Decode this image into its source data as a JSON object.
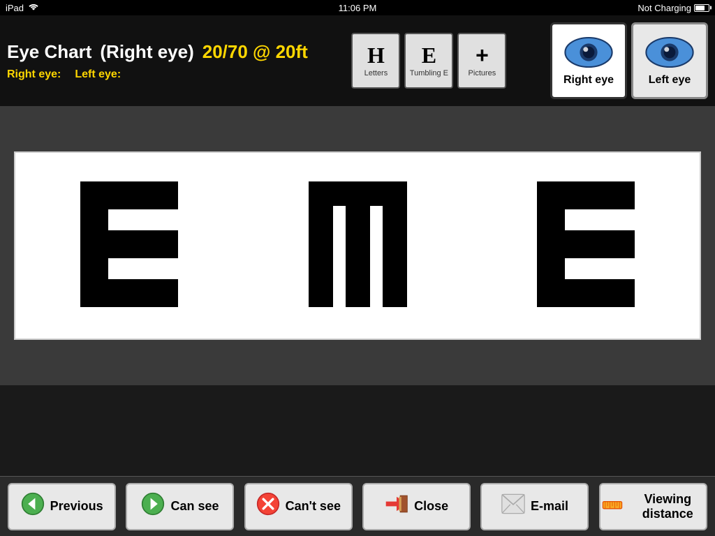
{
  "statusBar": {
    "device": "iPad",
    "time": "11:06 PM",
    "charging": "Not Charging"
  },
  "header": {
    "appName": "Eye Chart",
    "eyeMode": "(Right eye)",
    "acuity": "20/70 @ 20ft",
    "rightEyeLabel": "Right eye:",
    "leftEyeLabel": "Left eye:"
  },
  "chartTypes": [
    {
      "id": "letters",
      "symbol": "H",
      "label": "Letters"
    },
    {
      "id": "tumbling",
      "symbol": "E",
      "label": "Tumbling E"
    },
    {
      "id": "pictures",
      "symbol": "+",
      "label": "Pictures"
    }
  ],
  "eyeSelectors": [
    {
      "id": "right",
      "label": "Right eye",
      "active": true
    },
    {
      "id": "left",
      "label": "Left eye",
      "active": false
    }
  ],
  "letters": [
    "E-normal",
    "E-mirrored",
    "E-normal"
  ],
  "toolbar": {
    "buttons": [
      {
        "id": "previous",
        "label": "Previous",
        "icon": "←"
      },
      {
        "id": "can-see",
        "label": "Can see",
        "icon": "→"
      },
      {
        "id": "cant-see",
        "label": "Can't see",
        "icon": "✕"
      },
      {
        "id": "close",
        "label": "Close",
        "icon": "📋"
      },
      {
        "id": "email",
        "label": "E-mail",
        "icon": "✉"
      },
      {
        "id": "viewing-distance",
        "label": "Viewing distance",
        "icon": "📏"
      }
    ]
  }
}
